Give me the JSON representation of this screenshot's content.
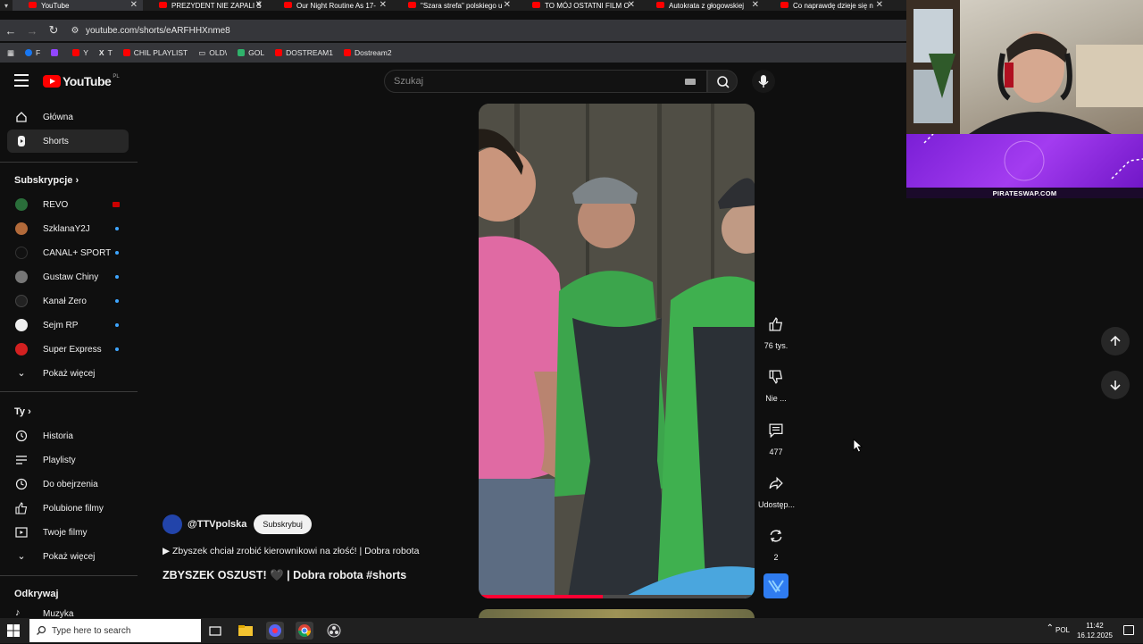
{
  "browser": {
    "tabs": [
      {
        "title": "YouTube",
        "active": true
      },
      {
        "title": "PREZYDENT NIE ZAPALI Ś"
      },
      {
        "title": "Our Night Routine As 17-"
      },
      {
        "title": "\"Szara strefa\" polskiego u"
      },
      {
        "title": "TO MÓJ OSTATNI FILM O"
      },
      {
        "title": "Autokrata z głogowskiej"
      },
      {
        "title": "Co naprawdę dzieje się n"
      }
    ],
    "url": "youtube.com/shorts/eARFHHXnme8",
    "bookmarks": [
      {
        "label": "F",
        "color": "#1877f2"
      },
      {
        "label": "",
        "color": "#9146ff"
      },
      {
        "label": "Y",
        "color": "#ff0000"
      },
      {
        "label": "T",
        "color": "#ffffff"
      },
      {
        "label": "CHIL PLAYLIST",
        "color": "#ff0000"
      },
      {
        "label": "OLD\\",
        "color": "#cccccc"
      },
      {
        "label": "GOL",
        "color": "#2fb26b"
      },
      {
        "label": "DOSTREAM1",
        "color": "#ff0000"
      },
      {
        "label": "Dostream2",
        "color": "#ff0000"
      }
    ]
  },
  "header": {
    "logo_text": "YouTube",
    "logo_region": "PL",
    "search_placeholder": "Szukaj"
  },
  "sidebar": {
    "main": [
      {
        "label": "Główna",
        "icon": "home-icon"
      },
      {
        "label": "Shorts",
        "icon": "shorts-icon",
        "active": true
      }
    ],
    "subscriptions_heading": "Subskrypcje",
    "subscriptions": [
      {
        "label": "REVO",
        "color": "#2a6e3a",
        "badge": "live-red"
      },
      {
        "label": "SzklanaY2J",
        "color": "#b26a3a",
        "badge": "dot"
      },
      {
        "label": "CANAL+ SPORT",
        "color": "#111111",
        "badge": "dot"
      },
      {
        "label": "Gustaw Chiny",
        "color": "#777777",
        "badge": "dot"
      },
      {
        "label": "Kanał Zero",
        "color": "#222222",
        "badge": "dot"
      },
      {
        "label": "Sejm RP",
        "color": "#eeeeee",
        "badge": "dot"
      },
      {
        "label": "Super Express",
        "color": "#d32020",
        "badge": "dot"
      }
    ],
    "show_more": "Pokaż więcej",
    "you_heading": "Ty",
    "you_items": [
      {
        "label": "Historia",
        "icon": "history-icon"
      },
      {
        "label": "Playlisty",
        "icon": "playlist-icon"
      },
      {
        "label": "Do obejrzenia",
        "icon": "watch-later-icon"
      },
      {
        "label": "Polubione filmy",
        "icon": "like-icon"
      },
      {
        "label": "Twoje filmy",
        "icon": "your-videos-icon"
      }
    ],
    "show_more_2": "Pokaż więcej",
    "explore_heading": "Odkrywaj",
    "explore_items": [
      {
        "label": "Muzyka",
        "icon": "music-icon"
      }
    ]
  },
  "short": {
    "channel": "@TTVpolska",
    "subscribe_label": "Subskrybuj",
    "description": "▶ Zbyszek chciał zrobić kierownikowi na złość! | Dobra robota",
    "title": "ZBYSZEK OSZUST! 🖤 | Dobra robota #shorts",
    "progress_fraction": 0.45,
    "actions": {
      "likes": "76 tys.",
      "dislike": "Nie ...",
      "comments": "477",
      "share": "Udostęp...",
      "remix": "2"
    }
  },
  "overlay": {
    "banner_text": "PIRATESWAP.COM"
  },
  "taskbar": {
    "search_placeholder": "Type here to search",
    "language": "POL",
    "time": "11:42",
    "date": "16.12.2025"
  }
}
